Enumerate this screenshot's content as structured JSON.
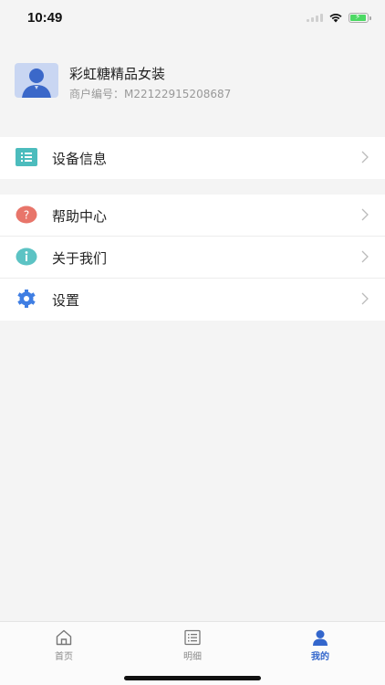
{
  "status_bar": {
    "time": "10:49"
  },
  "profile": {
    "name": "彩虹糖精品女装",
    "merchant_id": "商户编号：M22122915208687"
  },
  "menu": {
    "device_info": {
      "label": "设备信息",
      "icon": "list-icon",
      "color": "#4cbcbd"
    },
    "help_center": {
      "label": "帮助中心",
      "icon": "question-icon",
      "color": "#e8756a"
    },
    "about_us": {
      "label": "关于我们",
      "icon": "info-icon",
      "color": "#5cc3c4"
    },
    "settings": {
      "label": "设置",
      "icon": "gear-icon",
      "color": "#3f7ee3"
    }
  },
  "tab_bar": {
    "tabs": [
      {
        "label": "首页",
        "icon": "home-icon",
        "active": false
      },
      {
        "label": "明细",
        "icon": "list-icon",
        "active": false
      },
      {
        "label": "我的",
        "icon": "person-icon",
        "active": true
      }
    ]
  },
  "colors": {
    "accent": "#3366cc",
    "background": "#f4f4f4"
  }
}
